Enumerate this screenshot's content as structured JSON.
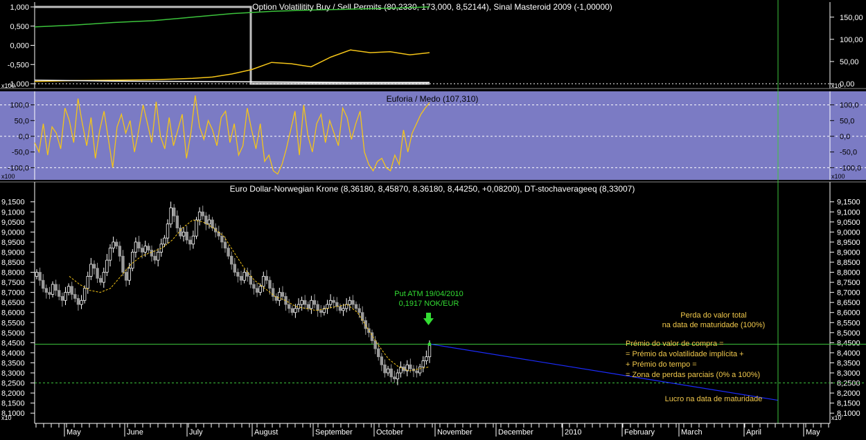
{
  "colors": {
    "background": "#000000",
    "panel_bg_mid": "#7b7bc4",
    "tick_color": "#ffffff",
    "green_line": "#3cc43c",
    "yellow": "#f5c518",
    "blue_line": "#1c2cff",
    "grey": "#bfbfbf",
    "annot_yellow": "#f2c94c",
    "annot_green": "#33dd33"
  },
  "panels": {
    "top": {
      "title": "Option Volatilitity Buy / Sell Permits (80,2330, 173,000, 8,52144), Sinal Masteroid 2009 (-1,00000)",
      "scale_tag_left": "x100",
      "scale_tag_right": "x10"
    },
    "middle": {
      "title": "Euforia / Medo (107,310)",
      "scale_tag_left": "x100",
      "scale_tag_right": "x100"
    },
    "bottom": {
      "title": "Euro Dollar-Norwegian Krone (8,36180, 8,45870, 8,36180, 8,44250, +0,08200), DT-stochaveragееq (8,33007)",
      "scale_tag_left": "x10",
      "scale_tag_right": "x10"
    }
  },
  "annotations": {
    "put_line1": "Put ATM 19/04/2010",
    "put_line2": "0,1917 NOK/EUR",
    "loss_line1": "Perda do valor total",
    "loss_line2": "na data de maturidade (100%)",
    "premium_line1": "Prémio do valor de compra =",
    "premium_line2": "= Prémio da volatilidade implícita +",
    "premium_line3": "+ Prémio do tempo =",
    "premium_line4": "= Zona de perdas parciais (0% a 100%)",
    "profit_line": "Lucro na data de maturidade"
  },
  "chart_data": [
    {
      "type": "line",
      "panel": "top",
      "title": "Option Volatilitity Buy / Sell Permits (80,2330, 173,000, 8,52144), Sinal Masteroid 2009 (-1,00000)",
      "left_axis_ticks": [
        "1,000",
        "0,500",
        "0,000",
        "-0,500",
        "-1,000"
      ],
      "left_axis_range": [
        -1.0,
        1.0
      ],
      "right_axis_ticks": [
        "150,00",
        "100,00",
        "50,00",
        "0,00"
      ],
      "right_axis_range": [
        0,
        173
      ],
      "series": [
        {
          "color": "#bfbfbf",
          "axis": "left",
          "x": [
            0,
            0.5,
            0.5,
            1.0
          ],
          "values": [
            1.0,
            1.0,
            -1.0,
            -1.0
          ]
        },
        {
          "color": "#3cc43c",
          "axis": "right",
          "x": [
            0,
            0.1,
            0.2,
            0.3,
            0.4,
            0.5,
            0.6,
            0.7,
            0.8,
            0.9,
            1.0
          ],
          "values": [
            128,
            132,
            138,
            142,
            150,
            158,
            163,
            166,
            168,
            170,
            173
          ]
        },
        {
          "color": "#f5c518",
          "axis": "right",
          "x": [
            0,
            0.1,
            0.2,
            0.3,
            0.4,
            0.45,
            0.5,
            0.55,
            0.6,
            0.65,
            0.7,
            0.75,
            0.8,
            0.85,
            0.9,
            0.95,
            1.0
          ],
          "values": [
            5,
            7,
            8,
            9,
            12,
            15,
            22,
            32,
            48,
            45,
            38,
            60,
            76,
            70,
            72,
            65,
            70
          ]
        },
        {
          "color": "#ffffff",
          "axis": "right",
          "x": [
            0,
            0.2,
            0.4,
            0.6,
            0.8,
            1.0
          ],
          "values": [
            8,
            6,
            5,
            4,
            3,
            3
          ]
        }
      ]
    },
    {
      "type": "line",
      "panel": "middle",
      "title": "Euforia / Medo (107,310)",
      "left_axis_ticks": [
        "100,0",
        "50,0",
        "0,0",
        "-50,0",
        "-100,0"
      ],
      "right_axis_ticks": [
        "100,0",
        "50,0",
        "0,0",
        "-50,0",
        "-100,0"
      ],
      "y_range": [
        -130,
        130
      ],
      "reference_lines": [
        100,
        0,
        -100
      ],
      "series": [
        {
          "name": "Euforia / Medo",
          "color": "#f5c518",
          "values": [
            -20,
            -50,
            40,
            -60,
            30,
            10,
            -40,
            90,
            50,
            -20,
            120,
            40,
            -30,
            60,
            -70,
            20,
            80,
            -10,
            -100,
            30,
            70,
            10,
            50,
            -50,
            20,
            100,
            40,
            -20,
            110,
            0,
            -40,
            60,
            -30,
            20,
            70,
            -70,
            10,
            130,
            30,
            -10,
            50,
            20,
            -30,
            60,
            80,
            -20,
            40,
            -60,
            -30,
            90,
            20,
            -40,
            40,
            -80,
            -60,
            -110,
            -120,
            -90,
            -40,
            20,
            80,
            -60,
            100,
            0,
            -50,
            40,
            70,
            -20,
            50,
            10,
            -30,
            90,
            60,
            -10,
            40,
            80,
            -50,
            -90,
            -110,
            -80,
            -70,
            -100,
            -110,
            -60,
            -90,
            20,
            -50,
            10,
            40,
            70,
            90,
            107
          ]
        }
      ]
    },
    {
      "type": "candlestick",
      "panel": "bottom",
      "title": "Euro Dollar-Norwegian Krone (8,36180, 8,45870, 8,36180, 8,44250, +0,08200), DT-stochaveragееq (8,33007)",
      "y_axis_ticks": [
        "9,1500",
        "9,1000",
        "9,0500",
        "9,0000",
        "8,9500",
        "8,9000",
        "8,8500",
        "8,8000",
        "8,7500",
        "8,7000",
        "8,6500",
        "8,6000",
        "8,5500",
        "8,5000",
        "8,4500",
        "8,4000",
        "8,3500",
        "8,3000",
        "8,2500",
        "8,2000",
        "8,1500",
        "8,1000"
      ],
      "y_range": [
        8.08,
        9.18
      ],
      "x_tick_labels": [
        "May",
        "June",
        "July",
        "August",
        "September",
        "October",
        "November",
        "December",
        "2010",
        "February",
        "March",
        "April",
        "May"
      ],
      "close": [
        8.8,
        8.76,
        8.72,
        8.7,
        8.69,
        8.74,
        8.71,
        8.68,
        8.66,
        8.7,
        8.73,
        8.69,
        8.67,
        8.64,
        8.66,
        8.72,
        8.78,
        8.84,
        8.82,
        8.77,
        8.75,
        8.8,
        8.86,
        8.92,
        8.95,
        8.93,
        8.88,
        8.8,
        8.76,
        8.82,
        8.9,
        8.95,
        8.92,
        8.9,
        8.93,
        8.91,
        8.88,
        8.86,
        8.9,
        8.94,
        8.97,
        9.04,
        9.12,
        9.08,
        9.02,
        8.98,
        9.0,
        8.96,
        8.94,
        8.98,
        9.06,
        9.1,
        9.08,
        9.04,
        9.06,
        9.02,
        9.0,
        8.98,
        8.95,
        8.92,
        8.88,
        8.84,
        8.8,
        8.78,
        8.76,
        8.8,
        8.78,
        8.74,
        8.72,
        8.7,
        8.73,
        8.78,
        8.76,
        8.72,
        8.68,
        8.66,
        8.7,
        8.68,
        8.64,
        8.62,
        8.6,
        8.62,
        8.64,
        8.66,
        8.64,
        8.62,
        8.66,
        8.64,
        8.61,
        8.6,
        8.62,
        8.64,
        8.66,
        8.65,
        8.63,
        8.61,
        8.62,
        8.64,
        8.66,
        8.64,
        8.62,
        8.6,
        8.56,
        8.52,
        8.5,
        8.46,
        8.42,
        8.38,
        8.34,
        8.3,
        8.32,
        8.28,
        8.27,
        8.3,
        8.33,
        8.31,
        8.34,
        8.32,
        8.31,
        8.3,
        8.33,
        8.36,
        8.38,
        8.4425
      ],
      "moving_average": [
        8.78,
        8.74,
        8.71,
        8.7,
        8.72,
        8.78,
        8.84,
        8.88,
        8.9,
        8.92,
        8.96,
        9.02,
        9.06,
        9.05,
        9.02,
        8.98,
        8.9,
        8.82,
        8.76,
        8.72,
        8.68,
        8.66,
        8.63,
        8.62,
        8.61,
        8.62,
        8.63,
        8.64,
        8.6,
        8.52,
        8.44,
        8.37,
        8.33,
        8.31,
        8.32,
        8.33
      ],
      "horizontal_lines": [
        {
          "value": 8.4425,
          "color": "#3cc43c",
          "style": "solid"
        },
        {
          "value": 8.25,
          "color": "#3cc43c",
          "style": "dashed"
        }
      ],
      "projection_line": {
        "from_value": 8.4425,
        "to_value": 8.25,
        "color": "#1c2cff"
      }
    }
  ]
}
